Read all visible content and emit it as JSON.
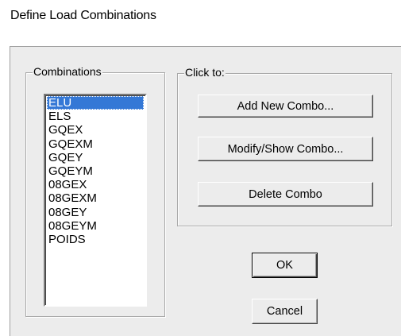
{
  "window": {
    "title": "Define Load Combinations"
  },
  "combinations": {
    "group_label": "Combinations",
    "selected_index": 0,
    "items": [
      "ELU",
      "ELS",
      "GQEX",
      "GQEXM",
      "GQEY",
      "GQEYM",
      "08GEX",
      "08GEXM",
      "08GEY",
      "08GEYM",
      "POIDS"
    ]
  },
  "actions": {
    "group_label": "Click to:",
    "add_label": "Add New Combo...",
    "modify_label": "Modify/Show Combo...",
    "delete_label": "Delete Combo"
  },
  "footer": {
    "ok_label": "OK",
    "cancel_label": "Cancel"
  },
  "colors": {
    "selection": "#3478d6",
    "dialog_background": "#ececec"
  }
}
